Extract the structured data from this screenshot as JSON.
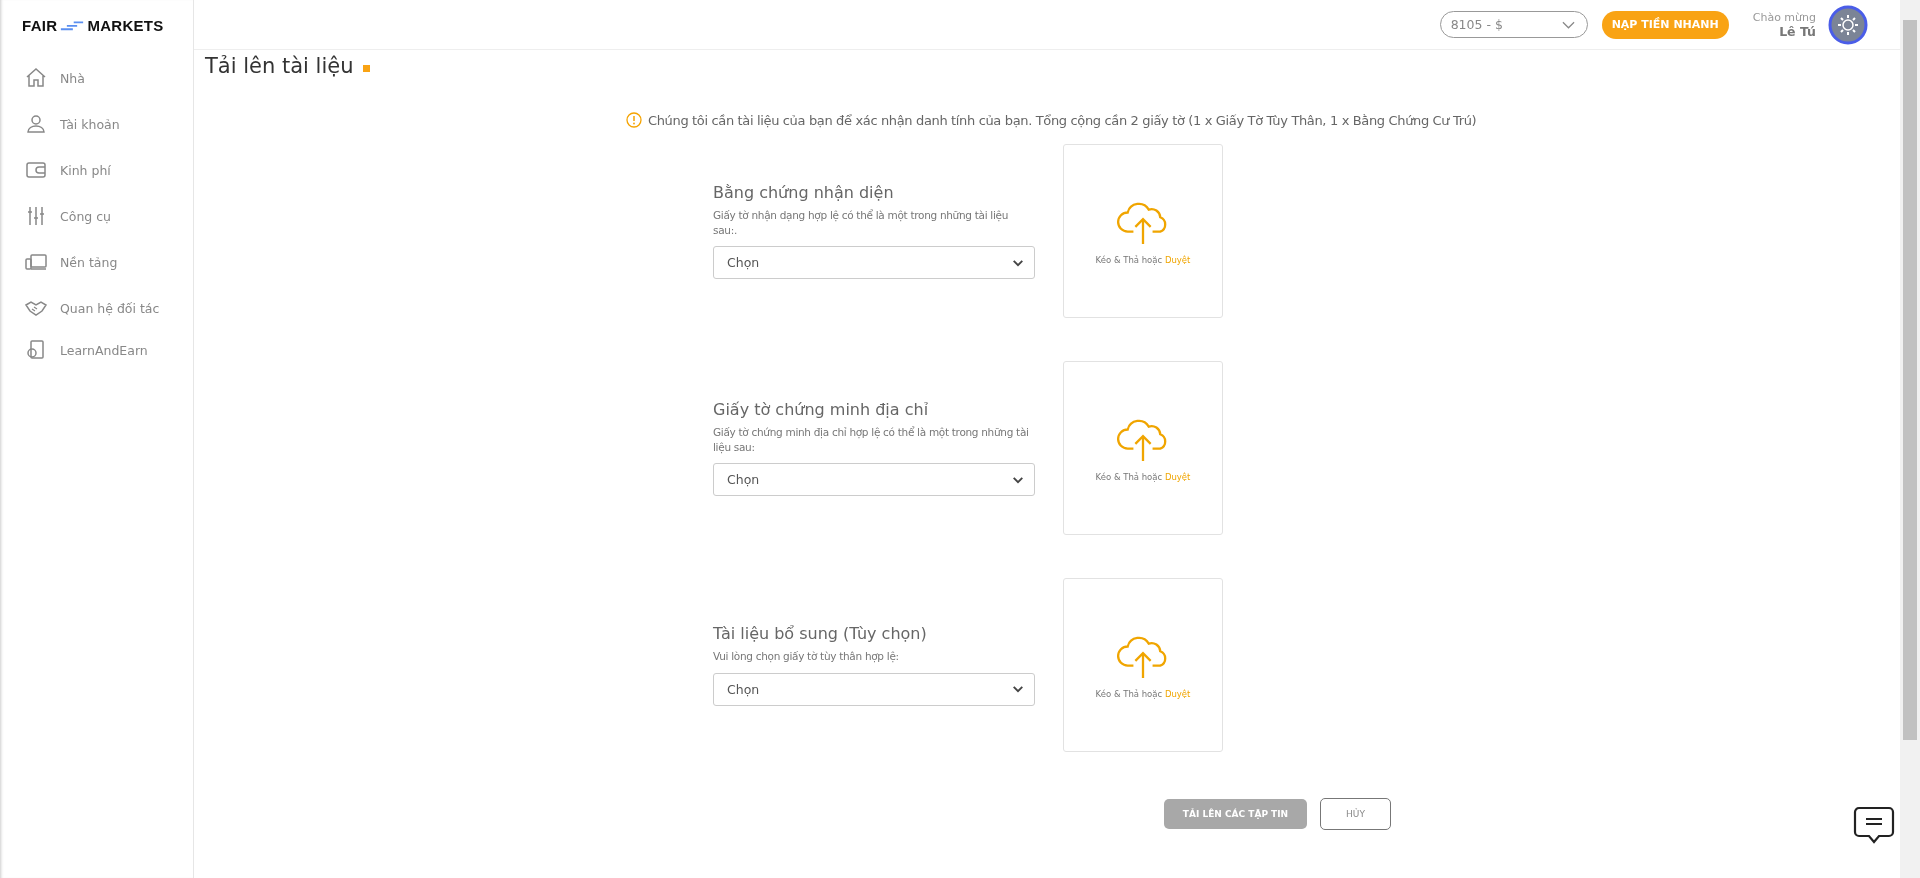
{
  "logo": {
    "left": "FAIR",
    "right": "MARKETS"
  },
  "sidebar": {
    "items": [
      {
        "label": "Nhà"
      },
      {
        "label": "Tài khoản"
      },
      {
        "label": "Kinh phí"
      },
      {
        "label": "Công cụ"
      },
      {
        "label": "Nền tảng"
      },
      {
        "label": "Quan hệ đối tác"
      },
      {
        "label": "LearnAndEarn"
      }
    ]
  },
  "header": {
    "account_select": {
      "value": "8105 - $"
    },
    "deposit_button": "NẠP TIỀN NHANH",
    "greeting": "Chào mừng",
    "user_name": "Lê Tú"
  },
  "page": {
    "title": "Tải lên tài liệu",
    "notice": "Chúng tôi cần tài liệu của bạn để xác nhận danh tính của bạn. Tổng cộng cần 2 giấy tờ (1 x Giấy Tờ Tùy Thân, 1 x Bằng Chứng Cư Trú)",
    "sections": [
      {
        "title": "Bằng chứng nhận diện",
        "hint": "Giấy tờ nhận dạng hợp lệ có thể là một trong những tài liệu sau:.",
        "select": "Chọn",
        "drop_text": "Kéo & Thả hoặc",
        "browse": "Duyệt"
      },
      {
        "title": "Giấy tờ chứng minh địa chỉ",
        "hint": "Giấy tờ chứng minh địa chỉ hợp lệ có thể là một trong những tài liệu sau:",
        "select": "Chọn",
        "drop_text": "Kéo & Thả hoặc",
        "browse": "Duyệt"
      },
      {
        "title": "Tài liệu bổ sung (Tùy chọn)",
        "hint": "Vui lòng chọn giấy tờ tùy thân hợp lệ:",
        "select": "Chọn",
        "drop_text": "Kéo & Thả hoặc",
        "browse": "Duyệt"
      }
    ],
    "buttons": [
      {
        "label": "TẢI LÊN CÁC TẬP TIN",
        "kind": "primary",
        "disabled": true
      },
      {
        "label": "HỦY",
        "kind": "outline",
        "disabled": false
      }
    ]
  }
}
